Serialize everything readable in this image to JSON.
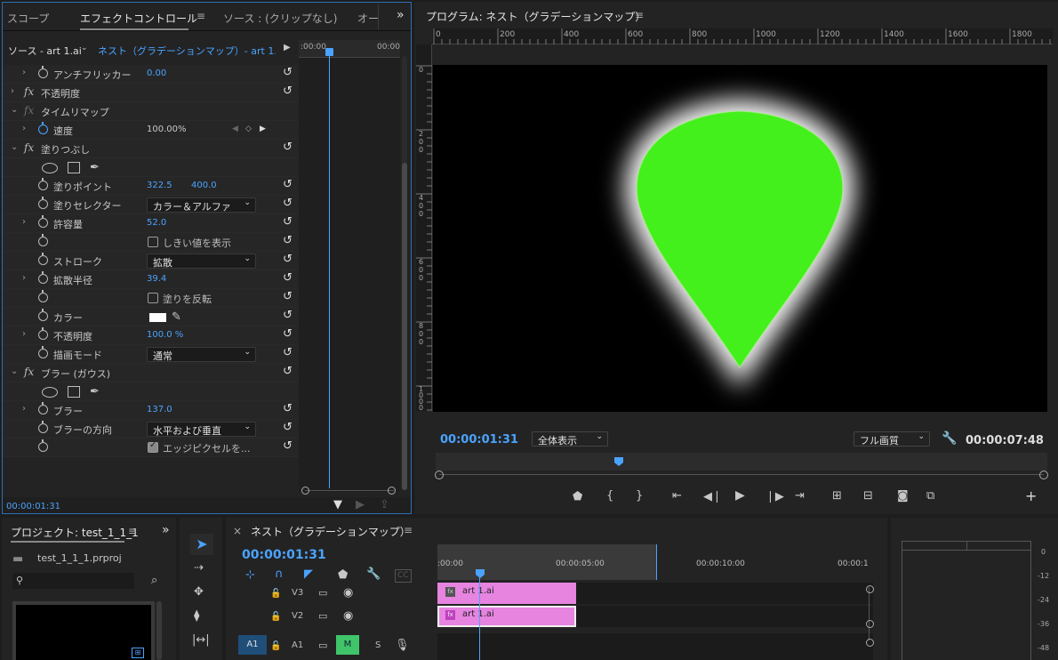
{
  "effect_panel": {
    "tabs": [
      "スコープ",
      "エフェクトコントロール",
      "ソース : (クリップなし)",
      "オー"
    ],
    "source_label": "ソース - art 1.ai",
    "sequence_label": "ネスト（グラデーションマップ）- art 1...",
    "tl_start": ":00:00",
    "tl_end": "00:00",
    "timecode": "00:00:01:31",
    "rows": {
      "antiflicker": {
        "label": "アンチフリッカー",
        "value": "0.00"
      },
      "opacity": {
        "label": "不透明度"
      },
      "time_remap": {
        "label": "タイムリマップ"
      },
      "speed": {
        "label": "速度",
        "value": "100.00%"
      },
      "fill": {
        "label": "塗りつぶし"
      },
      "fill_point": {
        "label": "塗りポイント",
        "x": "322.5",
        "y": "400.0"
      },
      "fill_selector": {
        "label": "塗りセレクター",
        "value": "カラー＆アルファ"
      },
      "tolerance": {
        "label": "許容量",
        "value": "52.0"
      },
      "show_threshold": {
        "label": "しきい値を表示"
      },
      "stroke": {
        "label": "ストローク",
        "value": "拡散"
      },
      "spread_radius": {
        "label": "拡散半径",
        "value": "39.4"
      },
      "invert_fill": {
        "label": "塗りを反転"
      },
      "color": {
        "label": "カラー",
        "swatch": "#ffffff"
      },
      "fill_opacity": {
        "label": "不透明度",
        "value": "100.0 %"
      },
      "blend_mode": {
        "label": "描画モード",
        "value": "通常"
      },
      "blur": {
        "label": "ブラー (ガウス)"
      },
      "blurriness": {
        "label": "ブラー",
        "value": "137.0"
      },
      "blur_dir": {
        "label": "ブラーの方向",
        "value": "水平および垂直"
      },
      "repeat_edge": {
        "label": "エッジピクセルを..."
      }
    }
  },
  "program": {
    "title": "プログラム: ネスト（グラデーションマップ）",
    "ruler_marks": [
      "0",
      "200",
      "400",
      "600",
      "800",
      "1000",
      "1200",
      "1400",
      "1600",
      "1800"
    ],
    "vruler_marks": [
      "0",
      "200",
      "400",
      "600",
      "800",
      "1000"
    ],
    "timecode": "00:00:01:31",
    "zoom": "全体表示",
    "quality": "フル画質",
    "duration": "00:00:07:48",
    "shape_color": "#44f01c"
  },
  "project": {
    "title": "プロジェクト: test_1_1_1",
    "file": "test_1_1_1.prproj"
  },
  "timeline": {
    "title": "ネスト（グラデーションマップ）",
    "timecode": "00:00:01:31",
    "ruler": [
      ":00:00",
      "00:00:05:00",
      "00:00:10:00",
      "00:00:1"
    ],
    "tracks": [
      {
        "name": "V3",
        "clip": "art 1.ai"
      },
      {
        "name": "V2",
        "clip": "art 1.ai"
      }
    ],
    "audio_track": {
      "left": "A1",
      "name": "A1",
      "m": "M",
      "s": "S"
    },
    "clip_color": "#e684e0"
  },
  "meter": {
    "labels": [
      "0",
      "-12",
      "-24",
      "-36",
      "-48"
    ]
  }
}
